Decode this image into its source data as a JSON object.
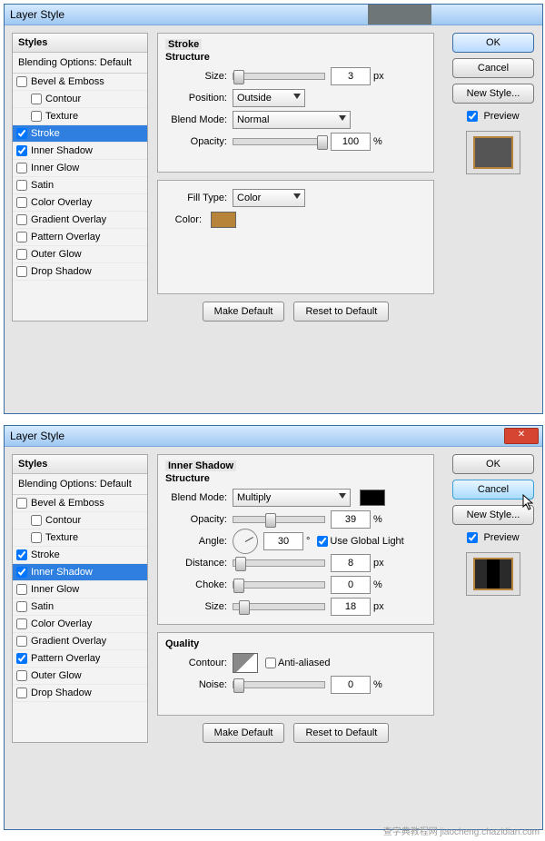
{
  "dlg1": {
    "title": "Layer Style",
    "styles_header": "Styles",
    "blend_default": "Blending Options: Default",
    "items": [
      {
        "label": "Bevel & Emboss",
        "checked": false,
        "indent": false
      },
      {
        "label": "Contour",
        "checked": false,
        "indent": true
      },
      {
        "label": "Texture",
        "checked": false,
        "indent": true
      },
      {
        "label": "Stroke",
        "checked": true,
        "indent": false,
        "selected": true
      },
      {
        "label": "Inner Shadow",
        "checked": true,
        "indent": false
      },
      {
        "label": "Inner Glow",
        "checked": false,
        "indent": false
      },
      {
        "label": "Satin",
        "checked": false,
        "indent": false
      },
      {
        "label": "Color Overlay",
        "checked": false,
        "indent": false
      },
      {
        "label": "Gradient Overlay",
        "checked": false,
        "indent": false
      },
      {
        "label": "Pattern Overlay",
        "checked": false,
        "indent": false
      },
      {
        "label": "Outer Glow",
        "checked": false,
        "indent": false
      },
      {
        "label": "Drop Shadow",
        "checked": false,
        "indent": false
      }
    ],
    "panel_title": "Stroke",
    "structure": "Structure",
    "labels": {
      "size": "Size:",
      "position": "Position:",
      "blend": "Blend Mode:",
      "opacity": "Opacity:",
      "filltype": "Fill Type:",
      "color": "Color:"
    },
    "values": {
      "size": "3",
      "size_unit": "px",
      "position": "Outside",
      "blend": "Normal",
      "opacity": "100",
      "opacity_unit": "%",
      "filltype": "Color",
      "color_hex": "#b7823a"
    },
    "positions": {
      "size_thumb": 0,
      "opacity_thumb": 92
    },
    "buttons": {
      "make_default": "Make Default",
      "reset_default": "Reset to Default"
    },
    "right": {
      "ok": "OK",
      "cancel": "Cancel",
      "newstyle": "New Style...",
      "preview": "Preview"
    }
  },
  "dlg2": {
    "title": "Layer Style",
    "styles_header": "Styles",
    "blend_default": "Blending Options: Default",
    "items": [
      {
        "label": "Bevel & Emboss",
        "checked": false,
        "indent": false
      },
      {
        "label": "Contour",
        "checked": false,
        "indent": true
      },
      {
        "label": "Texture",
        "checked": false,
        "indent": true
      },
      {
        "label": "Stroke",
        "checked": true,
        "indent": false
      },
      {
        "label": "Inner Shadow",
        "checked": true,
        "indent": false,
        "selected": true
      },
      {
        "label": "Inner Glow",
        "checked": false,
        "indent": false
      },
      {
        "label": "Satin",
        "checked": false,
        "indent": false
      },
      {
        "label": "Color Overlay",
        "checked": false,
        "indent": false
      },
      {
        "label": "Gradient Overlay",
        "checked": false,
        "indent": false
      },
      {
        "label": "Pattern Overlay",
        "checked": true,
        "indent": false
      },
      {
        "label": "Outer Glow",
        "checked": false,
        "indent": false
      },
      {
        "label": "Drop Shadow",
        "checked": false,
        "indent": false
      }
    ],
    "panel_title": "Inner Shadow",
    "structure": "Structure",
    "quality": "Quality",
    "labels": {
      "blend": "Blend Mode:",
      "opacity": "Opacity:",
      "angle": "Angle:",
      "global": "Use Global Light",
      "distance": "Distance:",
      "choke": "Choke:",
      "size": "Size:",
      "contour": "Contour:",
      "aa": "Anti-aliased",
      "noise": "Noise:"
    },
    "values": {
      "blend": "Multiply",
      "color_hex": "#000000",
      "opacity": "39",
      "opacity_unit": "%",
      "angle": "30",
      "angle_unit": "°",
      "global": true,
      "distance": "8",
      "distance_unit": "px",
      "choke": "0",
      "choke_unit": "%",
      "size": "18",
      "size_unit": "px",
      "aa": false,
      "noise": "0",
      "noise_unit": "%"
    },
    "positions": {
      "opacity_thumb": 35,
      "distance_thumb": 2,
      "choke_thumb": 0,
      "size_thumb": 6,
      "noise_thumb": 0
    },
    "buttons": {
      "make_default": "Make Default",
      "reset_default": "Reset to Default"
    },
    "right": {
      "ok": "OK",
      "cancel": "Cancel",
      "newstyle": "New Style...",
      "preview": "Preview"
    }
  },
  "watermark": "查字典教程网\njiaocheng.chazidian.com"
}
